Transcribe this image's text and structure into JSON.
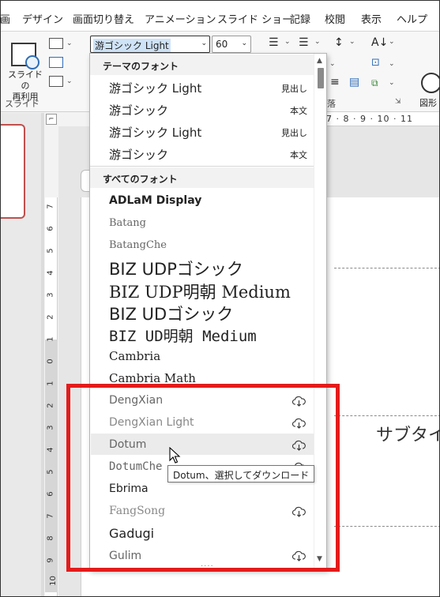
{
  "ribbon_tabs": [
    "画",
    "デザイン",
    "画面切り替え",
    "アニメーション",
    "スライド ショー",
    "記録",
    "校閲",
    "表示",
    "ヘルプ"
  ],
  "ribbon": {
    "reuse_label": "スライドの\n再利用",
    "slide_group": "スライド",
    "paragraph_group": "落",
    "font_name": "游ゴシック Light",
    "font_size": "60",
    "shape_label": "図形"
  },
  "ruler": {
    "h_text": "· 7 · 8 · 9 · 10 · 11",
    "v_numbers": [
      "7",
      "6",
      "5",
      "4",
      "3",
      "2",
      "1",
      "0",
      "1",
      "2",
      "3",
      "4",
      "5",
      "6",
      "7",
      "8",
      "9",
      "10"
    ]
  },
  "slide": {
    "subtitle": "サブタイ"
  },
  "font_menu": {
    "theme_header": "テーマのフォント",
    "all_header": "すべてのフォント",
    "theme_fonts": [
      {
        "name": "游ゴシック Light",
        "tag": "見出し"
      },
      {
        "name": "游ゴシック",
        "tag": "本文"
      },
      {
        "name": "游ゴシック Light",
        "tag": "見出し"
      },
      {
        "name": "游ゴシック",
        "tag": "本文"
      }
    ],
    "all_fonts": [
      {
        "name": "ADLaM Display",
        "download": false
      },
      {
        "name": "Batang",
        "download": false
      },
      {
        "name": "BatangChe",
        "download": false
      },
      {
        "name": "BIZ UDPゴシック",
        "download": false
      },
      {
        "name": "BIZ UDP明朝 Medium",
        "download": false
      },
      {
        "name": "BIZ UDゴシック",
        "download": false
      },
      {
        "name": "BIZ UD明朝 Medium",
        "download": false
      },
      {
        "name": "Cambria",
        "download": false
      },
      {
        "name": "Cambria Math",
        "download": false
      },
      {
        "name": "DengXian",
        "download": true
      },
      {
        "name": "DengXian Light",
        "download": true
      },
      {
        "name": "Dotum",
        "download": true
      },
      {
        "name": "DotumChe",
        "download": true
      },
      {
        "name": "Ebrima",
        "download": false
      },
      {
        "name": "FangSong",
        "download": true
      },
      {
        "name": "Gadugi",
        "download": false
      },
      {
        "name": "Gulim",
        "download": true
      }
    ],
    "grip": "....",
    "tooltip": "Dotum、選択してダウンロード"
  },
  "colors": {
    "highlight": "#e41b1b",
    "accent": "#c0504d"
  },
  "icons": [
    "cloud-download-icon",
    "mouse-pointer-icon",
    "shape-circle-icon",
    "reuse-slides-icon"
  ]
}
